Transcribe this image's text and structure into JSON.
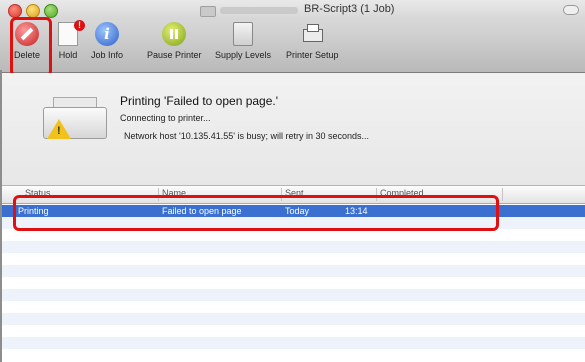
{
  "window": {
    "title": "BR-Script3 (1 Job)"
  },
  "toolbar": {
    "buttons": [
      {
        "label": "Delete",
        "icon": "delete-icon"
      },
      {
        "label": "Hold",
        "icon": "hold-icon"
      },
      {
        "label": "Job Info",
        "icon": "info-icon"
      },
      {
        "label": "Pause Printer",
        "icon": "pause-icon"
      },
      {
        "label": "Supply Levels",
        "icon": "supply-levels-icon"
      },
      {
        "label": "Printer Setup",
        "icon": "printer-setup-icon"
      }
    ]
  },
  "status": {
    "title": "Printing 'Failed to open page.'",
    "line1": "Connecting to printer...",
    "line2": "Network host '10.135.41.55' is busy; will retry in 30 seconds..."
  },
  "table": {
    "columns": [
      "Status",
      "Name",
      "Sent",
      "Completed"
    ],
    "rows": [
      {
        "status": "Printing",
        "name": "Failed to open page",
        "sent_day": "Today",
        "sent_time": "13:14",
        "completed": ""
      }
    ]
  },
  "colors": {
    "selection": "#3b6fd0",
    "highlight": "#e01010"
  }
}
